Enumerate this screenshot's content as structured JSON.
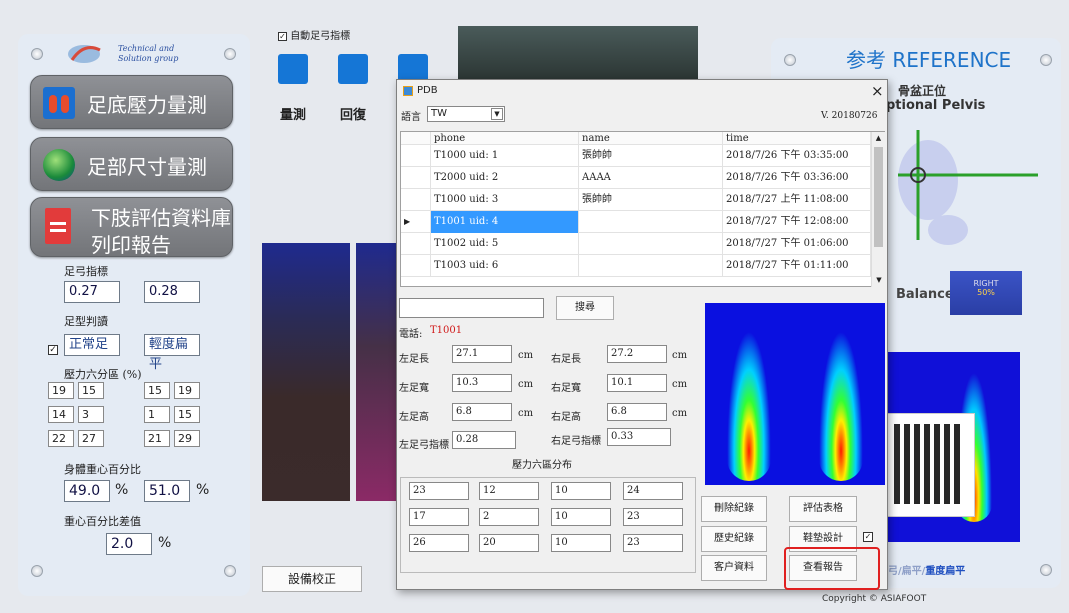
{
  "left": {
    "logo_line1": "Technical and",
    "logo_line2": "Solution group",
    "btn_foot_pressure": "足底壓力量測",
    "btn_foot_size": "足部尺寸量測",
    "btn_db_line1": "下肢評估資料庫",
    "btn_db_line2": "列印報告",
    "arch_label": "足弓指標",
    "arch_left": "0.27",
    "arch_right": "0.28",
    "foot_type_label": "足型判讀",
    "foot_type_left": "正常足",
    "foot_type_right": "輕度扁平",
    "pressure_label": "壓力六分區 (%)",
    "pressure": [
      [
        "19",
        "15",
        "15",
        "19"
      ],
      [
        "14",
        "3",
        "1",
        "15"
      ],
      [
        "22",
        "27",
        "21",
        "29"
      ]
    ],
    "cog_label": "身體重心百分比",
    "cog_left": "49.0",
    "cog_right": "51.0",
    "pct": "%",
    "diff_label": "重心百分比差值",
    "diff_value": "2.0"
  },
  "toolbar": {
    "auto_checkbox": "自動足弓指標",
    "measure": "量測",
    "restore": "回復",
    "calibrate": "設備校正"
  },
  "dialog": {
    "title": "PDB",
    "close": "×",
    "lang_label": "語言",
    "lang_value": "TW",
    "version": "V. 20180726",
    "columns": [
      "phone",
      "name",
      "time"
    ],
    "rows": [
      {
        "phone": "T1000 uid: 1",
        "name": "張帥帥",
        "time": "2018/7/26 下午 03:35:00"
      },
      {
        "phone": "T2000 uid: 2",
        "name": "AAAA",
        "time": "2018/7/26 下午 03:36:00"
      },
      {
        "phone": "T1000 uid: 3",
        "name": "張帥帥",
        "time": "2018/7/27 上午 11:08:00"
      },
      {
        "phone": "T1001 uid: 4",
        "name": "",
        "time": "2018/7/27 下午 12:08:00"
      },
      {
        "phone": "T1002 uid: 5",
        "name": "",
        "time": "2018/7/27 下午 01:06:00"
      },
      {
        "phone": "T1003 uid: 6",
        "name": "",
        "time": "2018/7/27 下午 01:11:00"
      }
    ],
    "search_btn": "搜尋",
    "phone_label": "電話:",
    "phone_value": "T1001",
    "left_len_label": "左足長",
    "left_len": "27.1",
    "right_len_label": "右足長",
    "right_len": "27.2",
    "left_wid_label": "左足寬",
    "left_wid": "10.3",
    "right_wid_label": "右足寬",
    "right_wid": "10.1",
    "left_h_label": "左足高",
    "left_h": "6.8",
    "right_h_label": "右足高",
    "right_h": "6.8",
    "unit": "cm",
    "left_arch_label": "左足弓指標",
    "left_arch": "0.28",
    "right_arch_label": "右足弓指標",
    "right_arch": "0.33",
    "pressure_title": "壓力六區分布",
    "pressure_cells": [
      [
        "23",
        "12",
        "10",
        "24"
      ],
      [
        "17",
        "2",
        "10",
        "23"
      ],
      [
        "26",
        "20",
        "10",
        "23"
      ]
    ],
    "btn_delete": "刪除紀錄",
    "btn_eval": "評估表格",
    "btn_history": "歷史紀錄",
    "btn_insole": "鞋墊設計",
    "btn_customer": "客户資料",
    "btn_report": "查看報告"
  },
  "right": {
    "ref_title": "参考 REFERENCE",
    "pelvis_line1": "骨盆正位",
    "pelvis_line2": "ptional Pelvis",
    "balance": "Balance",
    "right_badge_1": "RIGHT",
    "right_badge_2": "50%",
    "foot_type_bottom_1": "弓/扁平/",
    "foot_type_bottom_2": "重度扁平",
    "copyright": "Copyright © ASIAFOOT"
  },
  "colors": {
    "accent_red": "#e02020",
    "panel": "#e4ebf4",
    "title_blue": "#1e73c9"
  }
}
